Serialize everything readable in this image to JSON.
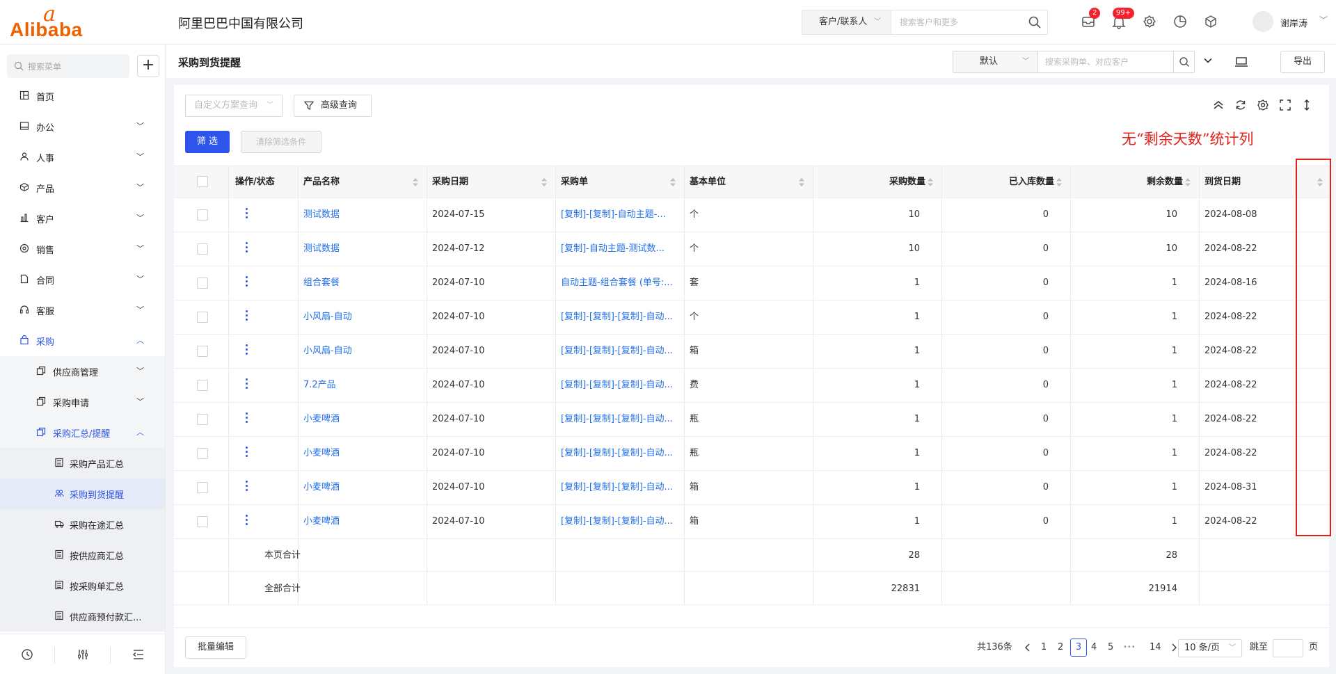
{
  "header": {
    "logo_text": "Alibaba",
    "logo_glyph": "a",
    "company": "阿里巴巴中国有限公司",
    "search_scope": "客户/联系人",
    "search_placeholder": "搜索客户和更多",
    "badge_inbox": "2",
    "badge_notify": "99+",
    "user_name": "谢岸涛"
  },
  "sidebar": {
    "search_placeholder": "搜索菜单",
    "add_label": "+",
    "items": [
      {
        "label": "首页"
      },
      {
        "label": "办公"
      },
      {
        "label": "人事"
      },
      {
        "label": "产品"
      },
      {
        "label": "客户"
      },
      {
        "label": "销售"
      },
      {
        "label": "合同"
      },
      {
        "label": "客服"
      },
      {
        "label": "采购"
      }
    ],
    "sub_items": [
      {
        "label": "供应商管理"
      },
      {
        "label": "采购申请"
      },
      {
        "label": "采购汇总/提醒"
      }
    ],
    "sub2_items": [
      {
        "label": "采购产品汇总"
      },
      {
        "label": "采购到货提醒"
      },
      {
        "label": "采购在途汇总"
      },
      {
        "label": "按供应商汇总"
      },
      {
        "label": "按采购单汇总"
      },
      {
        "label": "供应商预付款汇..."
      }
    ]
  },
  "titlebar": {
    "title": "采购到货提醒",
    "view_select": "默认",
    "search_placeholder": "搜索采购单、对应客户",
    "export_label": "导出"
  },
  "toolbar": {
    "scheme_placeholder": "自定义方案查询",
    "advanced_label": "高级查询",
    "filter_label": "筛 选",
    "clear_label": "清除筛选条件"
  },
  "annotation": {
    "text": "无“剩余天数”统计列",
    "color": "#e0201a"
  },
  "table": {
    "columns": [
      "操作/状态",
      "产品名称",
      "采购日期",
      "采购单",
      "基本单位",
      "采购数量",
      "已入库数量",
      "剩余数量",
      "到货日期"
    ],
    "rows": [
      {
        "product": "测试数据",
        "date": "2024-07-15",
        "order": "[复制]-[复制]-自动主题-...",
        "unit": "个",
        "qty": "10",
        "stocked": "0",
        "remain": "10",
        "arrival": "2024-08-08"
      },
      {
        "product": "测试数据",
        "date": "2024-07-12",
        "order": "[复制]-自动主题-测试数...",
        "unit": "个",
        "qty": "10",
        "stocked": "0",
        "remain": "10",
        "arrival": "2024-08-22"
      },
      {
        "product": "组合套餐",
        "date": "2024-07-10",
        "order": "自动主题-组合套餐 (单号:...",
        "unit": "套",
        "qty": "1",
        "stocked": "0",
        "remain": "1",
        "arrival": "2024-08-16"
      },
      {
        "product": "小风扇-自动",
        "date": "2024-07-10",
        "order": "[复制]-[复制]-[复制]-自动...",
        "unit": "个",
        "qty": "1",
        "stocked": "0",
        "remain": "1",
        "arrival": "2024-08-22"
      },
      {
        "product": "小风扇-自动",
        "date": "2024-07-10",
        "order": "[复制]-[复制]-[复制]-自动...",
        "unit": "箱",
        "qty": "1",
        "stocked": "0",
        "remain": "1",
        "arrival": "2024-08-22"
      },
      {
        "product": "7.2产品",
        "date": "2024-07-10",
        "order": "[复制]-[复制]-[复制]-自动...",
        "unit": "费",
        "qty": "1",
        "stocked": "0",
        "remain": "1",
        "arrival": "2024-08-22"
      },
      {
        "product": "小麦啤酒",
        "date": "2024-07-10",
        "order": "[复制]-[复制]-[复制]-自动...",
        "unit": "瓶",
        "qty": "1",
        "stocked": "0",
        "remain": "1",
        "arrival": "2024-08-22"
      },
      {
        "product": "小麦啤酒",
        "date": "2024-07-10",
        "order": "[复制]-[复制]-[复制]-自动...",
        "unit": "瓶",
        "qty": "1",
        "stocked": "0",
        "remain": "1",
        "arrival": "2024-08-22"
      },
      {
        "product": "小麦啤酒",
        "date": "2024-07-10",
        "order": "[复制]-[复制]-[复制]-自动...",
        "unit": "箱",
        "qty": "1",
        "stocked": "0",
        "remain": "1",
        "arrival": "2024-08-31"
      },
      {
        "product": "小麦啤酒",
        "date": "2024-07-10",
        "order": "[复制]-[复制]-[复制]-自动...",
        "unit": "箱",
        "qty": "1",
        "stocked": "0",
        "remain": "1",
        "arrival": "2024-08-22"
      }
    ],
    "page_total": {
      "label": "本页合计",
      "qty": "28",
      "remain": "28"
    },
    "all_total": {
      "label": "全部合计",
      "qty": "22831",
      "remain": "21914"
    }
  },
  "pagination": {
    "batch_label": "批量编辑",
    "total_text": "共136条",
    "pages": [
      "1",
      "2",
      "3",
      "4",
      "5",
      "14"
    ],
    "current": "3",
    "ellipsis": "•••",
    "page_size": "10 条/页",
    "jump_label": "跳至",
    "page_suffix": "页"
  },
  "colors": {
    "accent": "#2f54eb",
    "link": "#1f6ee8",
    "brand": "#f06000"
  }
}
